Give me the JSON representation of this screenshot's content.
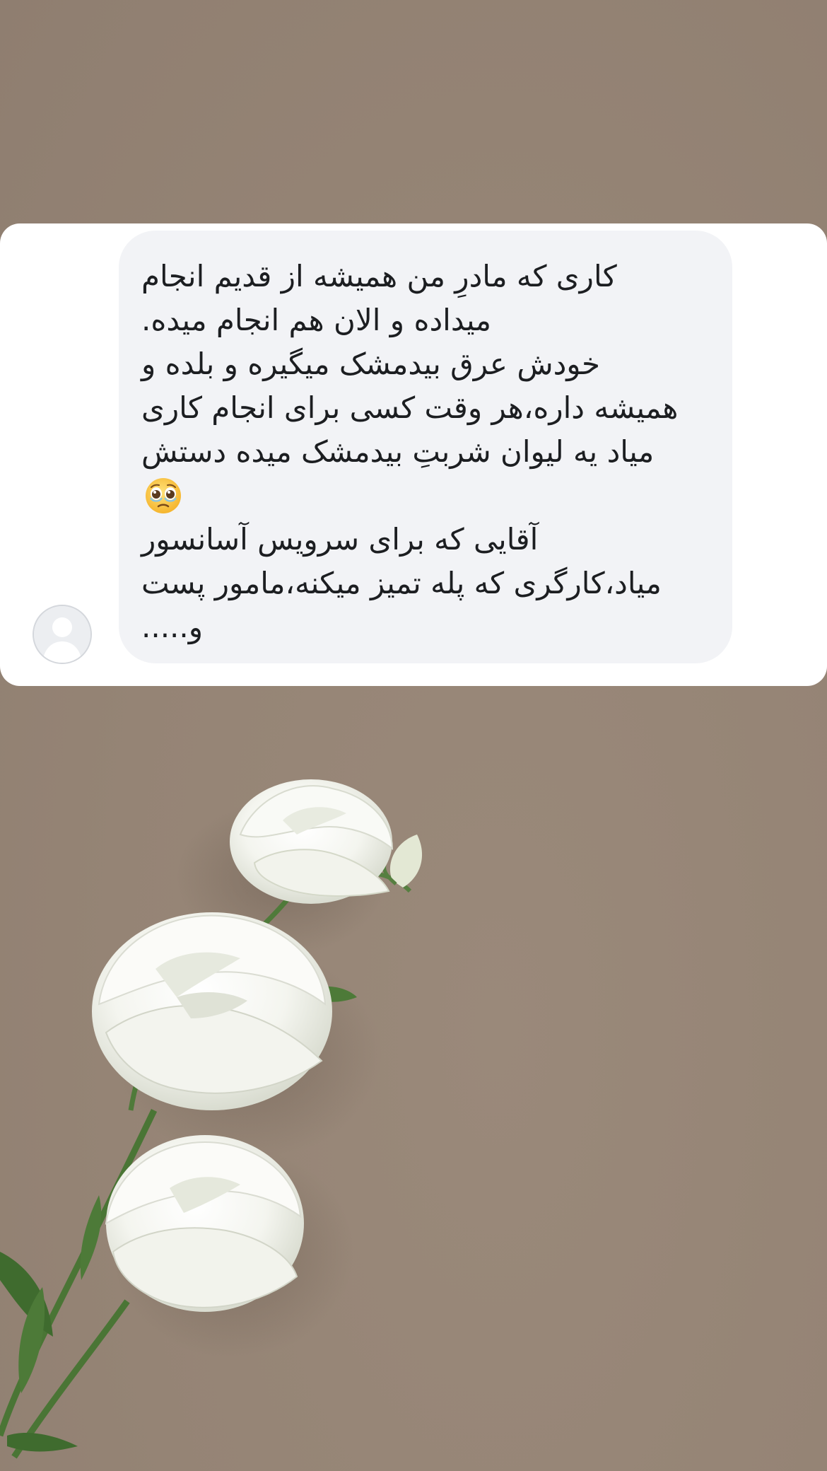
{
  "message": {
    "lines": [
      "کاری که مادرِ من همیشه از قدیم انجام",
      "میداده و الان هم انجام میده.",
      "خودش عرق بیدمشک میگیره و بلده و",
      "همیشه داره،هر وقت کسی برای انجام کاری",
      "میاد یه لیوان شربتِ بیدمشک میده دستش",
      "",
      "آقایی که برای سرویس آسانسور",
      "میاد،کارگری که پله تمیز میکنه،مامور پست",
      "و....."
    ],
    "emoji": "pleading-face-emoji"
  },
  "avatar": {
    "icon": "default-profile-icon"
  },
  "background": {
    "color": "#958475",
    "decoration": "white-roses"
  },
  "colors": {
    "card": "#ffffff",
    "bubble": "#f2f3f6",
    "text": "#1c1e21"
  }
}
